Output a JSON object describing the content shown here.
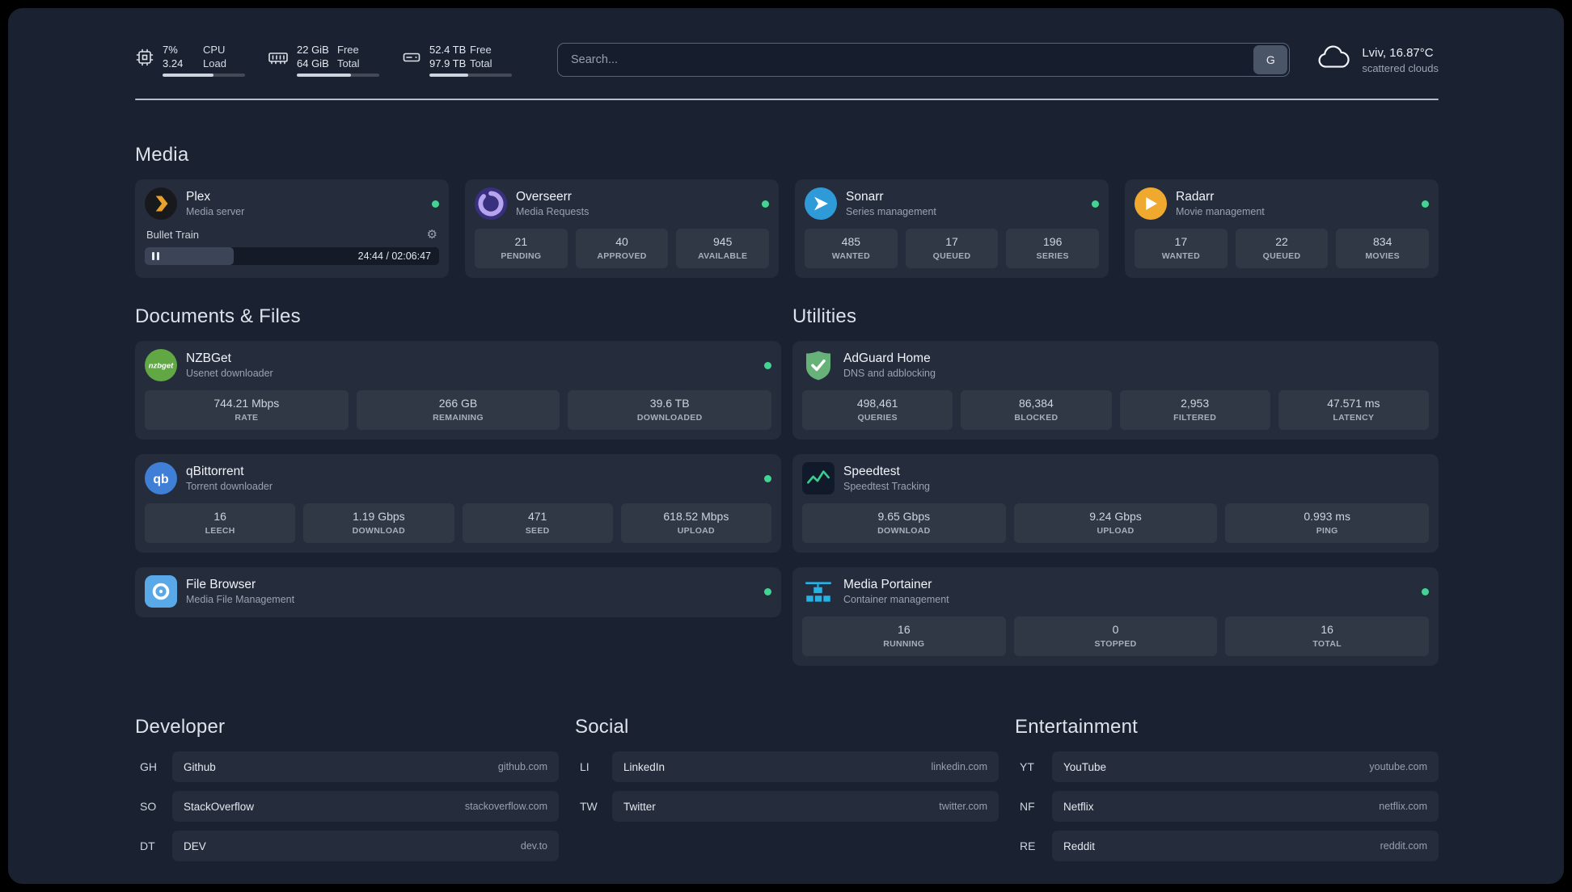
{
  "topbar": {
    "resources": [
      {
        "name": "cpu",
        "rows": [
          {
            "value": "7%",
            "label": "CPU"
          },
          {
            "value": "3.24",
            "label": "Load"
          }
        ],
        "progress_pct": 62
      },
      {
        "name": "memory",
        "rows": [
          {
            "value": "22 GiB",
            "label": "Free"
          },
          {
            "value": "64 GiB",
            "label": "Total"
          }
        ],
        "progress_pct": 66
      },
      {
        "name": "disk",
        "rows": [
          {
            "value": "52.4 TB",
            "label": "Free"
          },
          {
            "value": "97.9 TB",
            "label": "Total"
          }
        ],
        "progress_pct": 47
      }
    ],
    "search": {
      "placeholder": "Search...",
      "button_label": "G"
    },
    "weather": {
      "location": "Lviv, 16.87°C",
      "condition": "scattered clouds"
    }
  },
  "sections": {
    "media": {
      "title": "Media",
      "plex": {
        "name": "Plex",
        "description": "Media server",
        "player": {
          "track_title": "Bullet Train",
          "time": "24:44 / 02:06:47"
        }
      },
      "overseerr": {
        "name": "Overseerr",
        "description": "Media Requests",
        "stats": [
          {
            "value": "21",
            "label": "PENDING"
          },
          {
            "value": "40",
            "label": "APPROVED"
          },
          {
            "value": "945",
            "label": "AVAILABLE"
          }
        ]
      },
      "sonarr": {
        "name": "Sonarr",
        "description": "Series management",
        "stats": [
          {
            "value": "485",
            "label": "WANTED"
          },
          {
            "value": "17",
            "label": "QUEUED"
          },
          {
            "value": "196",
            "label": "SERIES"
          }
        ]
      },
      "radarr": {
        "name": "Radarr",
        "description": "Movie management",
        "stats": [
          {
            "value": "17",
            "label": "WANTED"
          },
          {
            "value": "22",
            "label": "QUEUED"
          },
          {
            "value": "834",
            "label": "MOVIES"
          }
        ]
      }
    },
    "documents": {
      "title": "Documents & Files",
      "nzbget": {
        "name": "NZBGet",
        "description": "Usenet downloader",
        "stats": [
          {
            "value": "744.21 Mbps",
            "label": "RATE"
          },
          {
            "value": "266 GB",
            "label": "REMAINING"
          },
          {
            "value": "39.6 TB",
            "label": "DOWNLOADED"
          }
        ]
      },
      "qbittorrent": {
        "name": "qBittorrent",
        "description": "Torrent downloader",
        "stats": [
          {
            "value": "16",
            "label": "LEECH"
          },
          {
            "value": "1.19 Gbps",
            "label": "DOWNLOAD"
          },
          {
            "value": "471",
            "label": "SEED"
          },
          {
            "value": "618.52 Mbps",
            "label": "UPLOAD"
          }
        ]
      },
      "filebrowser": {
        "name": "File Browser",
        "description": "Media File Management"
      }
    },
    "utilities": {
      "title": "Utilities",
      "adguard": {
        "name": "AdGuard Home",
        "description": "DNS and adblocking",
        "stats": [
          {
            "value": "498,461",
            "label": "QUERIES"
          },
          {
            "value": "86,384",
            "label": "BLOCKED"
          },
          {
            "value": "2,953",
            "label": "FILTERED"
          },
          {
            "value": "47.571 ms",
            "label": "LATENCY"
          }
        ]
      },
      "speedtest": {
        "name": "Speedtest",
        "description": "Speedtest Tracking",
        "stats": [
          {
            "value": "9.65 Gbps",
            "label": "DOWNLOAD"
          },
          {
            "value": "9.24 Gbps",
            "label": "UPLOAD"
          },
          {
            "value": "0.993 ms",
            "label": "PING"
          }
        ]
      },
      "portainer": {
        "name": "Media Portainer",
        "description": "Container management",
        "stats": [
          {
            "value": "16",
            "label": "RUNNING"
          },
          {
            "value": "0",
            "label": "STOPPED"
          },
          {
            "value": "16",
            "label": "TOTAL"
          }
        ]
      }
    },
    "bookmarks": [
      {
        "title": "Developer",
        "items": [
          {
            "abbr": "GH",
            "name": "Github",
            "domain": "github.com"
          },
          {
            "abbr": "SO",
            "name": "StackOverflow",
            "domain": "stackoverflow.com"
          },
          {
            "abbr": "DT",
            "name": "DEV",
            "domain": "dev.to"
          }
        ]
      },
      {
        "title": "Social",
        "items": [
          {
            "abbr": "LI",
            "name": "LinkedIn",
            "domain": "linkedin.com"
          },
          {
            "abbr": "TW",
            "name": "Twitter",
            "domain": "twitter.com"
          }
        ]
      },
      {
        "title": "Entertainment",
        "items": [
          {
            "abbr": "YT",
            "name": "YouTube",
            "domain": "youtube.com"
          },
          {
            "abbr": "NF",
            "name": "Netflix",
            "domain": "netflix.com"
          },
          {
            "abbr": "RE",
            "name": "Reddit",
            "domain": "reddit.com"
          }
        ]
      }
    ]
  },
  "colors": {
    "status_online": "#41d492",
    "accent_green": "#35d08e"
  }
}
